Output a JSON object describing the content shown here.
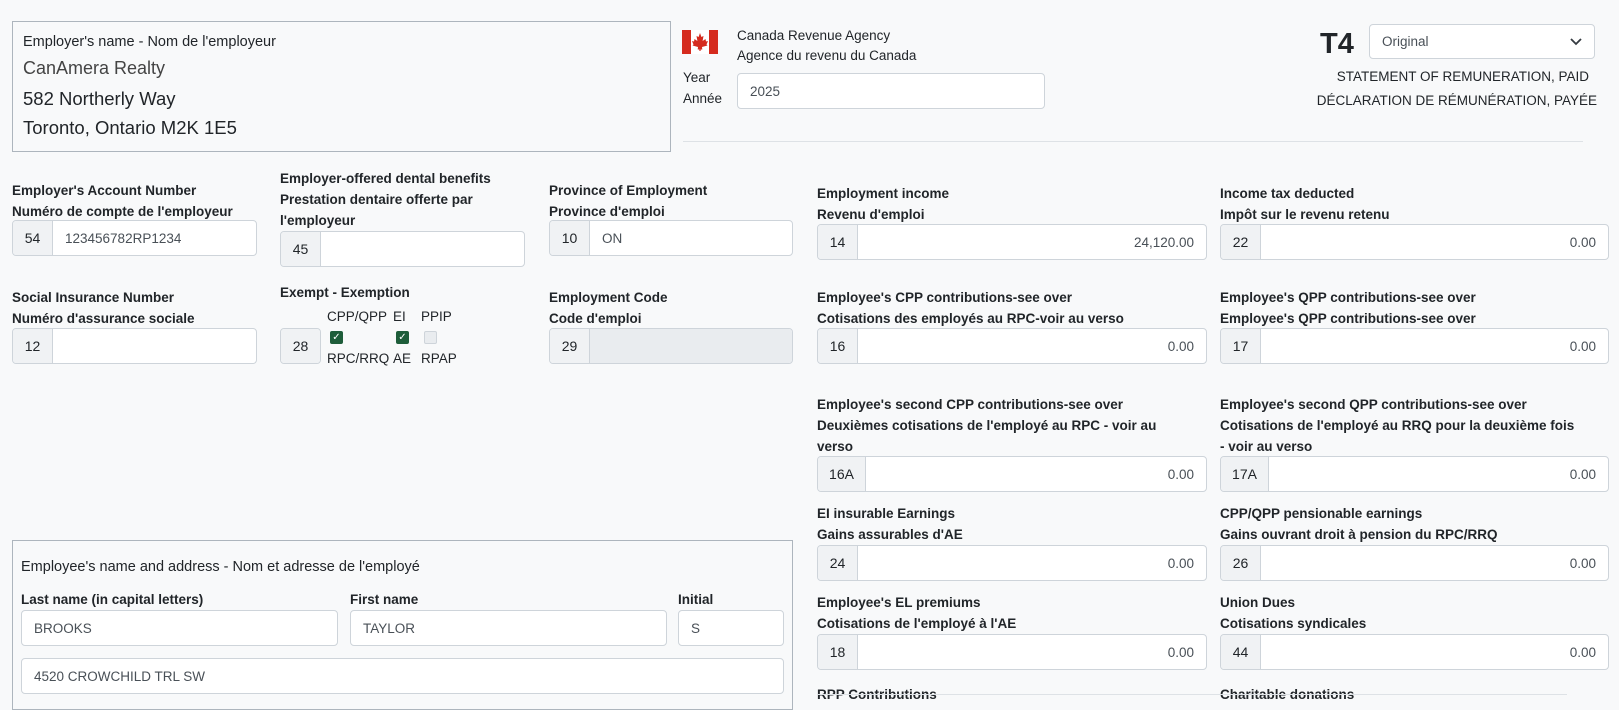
{
  "employer": {
    "label": "Employer's name - Nom de l'employeur",
    "name": "CanAmera Realty",
    "address1": "582 Northerly Way",
    "address2": "Toronto, Ontario M2K 1E5"
  },
  "agency": {
    "line1": "Canada Revenue Agency",
    "line2": "Agence du revenu du Canada",
    "year_label_en": "Year",
    "year_label_fr": "Année",
    "year_value": "2025"
  },
  "form": {
    "code": "T4",
    "type_selected": "Original",
    "title_en": "STATEMENT OF REMUNERATION, PAID",
    "title_fr": "DÉCLARATION DE RÉMUNÉRATION, PAYÉE"
  },
  "fields": {
    "account": {
      "label1": "Employer's Account Number",
      "label2": "Numéro de compte de l'employeur",
      "box": "54",
      "value": "123456782RP1234"
    },
    "dental": {
      "label1": "Employer-offered dental benefits",
      "label2": "Prestation dentaire offerte par",
      "label3": "l'employeur",
      "box": "45",
      "value": ""
    },
    "province": {
      "label1": "Province of Employment",
      "label2": "Province d'emploi",
      "box": "10",
      "value": "ON"
    },
    "sin": {
      "label1": "Social Insurance Number",
      "label2": "Numéro d'assurance sociale",
      "box": "12",
      "value": ""
    },
    "exempt": {
      "label": "Exempt - Exemption",
      "box": "28",
      "items": [
        {
          "top": "CPP/QPP",
          "bottom": "RPC/RRQ",
          "checked": true
        },
        {
          "top": "EI",
          "bottom": "AE",
          "checked": true
        },
        {
          "top": "PPIP",
          "bottom": "RPAP",
          "checked": false
        }
      ]
    },
    "emp_code": {
      "label1": "Employment Code",
      "label2": "Code d'emploi",
      "box": "29",
      "value": ""
    },
    "income": {
      "label1": "Employment income",
      "label2": "Revenu d'emploi",
      "box": "14",
      "value": "24,120.00"
    },
    "tax": {
      "label1": "Income tax deducted",
      "label2": "Impôt sur le revenu retenu",
      "box": "22",
      "value": "0.00"
    },
    "cpp": {
      "label1": "Employee's CPP contributions-see over",
      "label2": "Cotisations des employés au RPC-voir au verso",
      "box": "16",
      "value": "0.00"
    },
    "qpp": {
      "label1": "Employee's QPP contributions-see over",
      "label2": "Employee's QPP contributions-see over",
      "box": "17",
      "value": "0.00"
    },
    "cpp2": {
      "label1": "Employee's second CPP contributions-see over",
      "label2": "Deuxièmes cotisations de l'employé au RPC - voir au",
      "label3": "verso",
      "box": "16A",
      "value": "0.00"
    },
    "qpp2": {
      "label1": "Employee's second QPP contributions-see over",
      "label2": "Cotisations de l'employé au RRQ pour la deuxième fois",
      "label3": "- voir au verso",
      "box": "17A",
      "value": "0.00"
    },
    "ei_earn": {
      "label1": "EI insurable Earnings",
      "label2": "Gains assurables d'AE",
      "box": "24",
      "value": "0.00"
    },
    "pens_earn": {
      "label1": "CPP/QPP pensionable earnings",
      "label2": "Gains ouvrant droit à pension du RPC/RRQ",
      "box": "26",
      "value": "0.00"
    },
    "ei_prem": {
      "label1": "Employee's EL premiums",
      "label2": "Cotisations de l'employé à l'AE",
      "box": "18",
      "value": "0.00"
    },
    "union": {
      "label1": "Union Dues",
      "label2": "Cotisations syndicales",
      "box": "44",
      "value": "0.00"
    },
    "rpp_label": "RPP Contributions",
    "charity_label": "Charitable donations"
  },
  "employee": {
    "heading": "Employee's name and address - Nom et adresse de l'employé",
    "last_label": "Last name (in capital letters)",
    "first_label": "First name",
    "initial_label": "Initial",
    "last_value": "BROOKS",
    "first_value": "TAYLOR",
    "initial_value": "S",
    "address_value": "4520 CROWCHILD TRL SW"
  },
  "colors": {
    "flag_red": "#d52b1e",
    "check_green": "#1e5d3a"
  }
}
